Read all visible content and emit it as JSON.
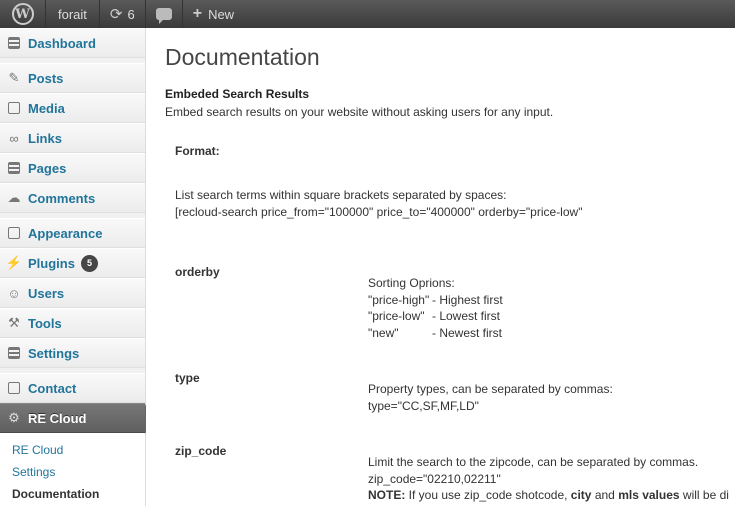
{
  "admin_bar": {
    "site_name": "forait",
    "updates_count": "6",
    "new_label": "New"
  },
  "sidebar": {
    "items": [
      {
        "label": "Dashboard",
        "icon": "dashboard-icon"
      },
      {
        "label": "Posts",
        "icon": "pin-icon"
      },
      {
        "label": "Media",
        "icon": "media-icon"
      },
      {
        "label": "Links",
        "icon": "link-icon"
      },
      {
        "label": "Pages",
        "icon": "pages-icon"
      },
      {
        "label": "Comments",
        "icon": "comment-icon"
      },
      {
        "label": "Appearance",
        "icon": "appearance-icon"
      },
      {
        "label": "Plugins",
        "icon": "plug-icon",
        "badge": "5"
      },
      {
        "label": "Users",
        "icon": "users-icon"
      },
      {
        "label": "Tools",
        "icon": "tools-icon"
      },
      {
        "label": "Settings",
        "icon": "settings-icon"
      },
      {
        "label": "Contact",
        "icon": "contact-icon"
      },
      {
        "label": "RE Cloud",
        "icon": "gear-icon"
      }
    ],
    "submenu": [
      "RE Cloud",
      "Settings",
      "Documentation"
    ]
  },
  "main": {
    "title": "Documentation",
    "section_title": "Embeded Search Results",
    "section_desc": "Embed search results on your website without asking users for any input.",
    "format": {
      "label": "Format:",
      "line1": "List search terms within square brackets separated by spaces:",
      "line2": "[recloud-search price_from=\"100000\" price_to=\"400000\" orderby=\"price-low\""
    },
    "orderby": {
      "name": "orderby",
      "heading": "Sorting Oprions:",
      "options": [
        {
          "key": "\"price-high\"",
          "desc": "- Highest first"
        },
        {
          "key": "\"price-low\"",
          "desc": "- Lowest first"
        },
        {
          "key": "\"new\"",
          "desc": "- Newest first"
        }
      ]
    },
    "type": {
      "name": "type",
      "line1": "Property types, can be separated by commas:",
      "line2": "type=\"CC,SF,MF,LD\""
    },
    "zip_code": {
      "name": "zip_code",
      "line1": "Limit the search to the zipcode, can be separated by commas.",
      "line2": "zip_code=\"02210,02211\"",
      "note_label": "NOTE:",
      "note_a": " If you use zip_code shotcode, ",
      "note_city": "city",
      "note_and": " and ",
      "note_mls": "mls values",
      "note_end": " will be di"
    }
  },
  "colors": {
    "admin_bar": "#464646",
    "link": "#21759b",
    "current_menu": "#6d6d6d"
  }
}
